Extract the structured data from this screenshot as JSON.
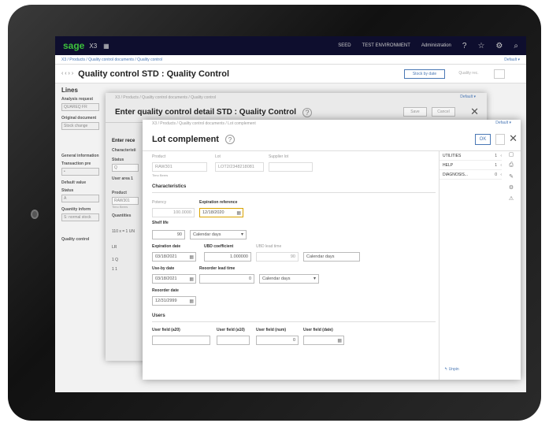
{
  "topbar": {
    "logo": "sage",
    "product": "X3",
    "menu_icon": "grid-icon",
    "links": [
      "SEED",
      "TEST ENVIRONMENT",
      "Administration"
    ],
    "icons": [
      "help-icon",
      "star-icon",
      "settings-icon",
      "search-icon"
    ]
  },
  "breadcrumb": {
    "path": "X3 / Products / Quality control documents / Quality control",
    "default_label": "Default ▾"
  },
  "page": {
    "arrows": "‹ ‹ › ›",
    "title": "Quality control STD : Quality Control",
    "button_primary": "Stock by date",
    "button_secondary": "Quality rec."
  },
  "left_panel": {
    "heading": "Lines",
    "analysis_request_label": "Analysis request",
    "analysis_request_value": "QUAREQ FR",
    "original_document_label": "Original document",
    "original_document_value": "Stock change",
    "general_information_label": "General information",
    "transaction_label": "Transaction pre",
    "transaction_value": "•",
    "default_value_label": "Default value",
    "status_label": "Status",
    "status_value": "A",
    "quantity_label": "Quantity inform",
    "quantity_value": "S: normal stock",
    "quality_control_label": "Quality control"
  },
  "modal1": {
    "crumb": "X3 / Products / Quality control documents / Quality control",
    "default_label": "Default ▾",
    "title": "Enter quality control detail STD : Quality Control",
    "help": "?",
    "btn_save": "Save",
    "btn_cancel": "Cancel",
    "close": "✕",
    "left": {
      "section": "Enter rece",
      "characteristics": "Characteristi",
      "status_label": "Status",
      "status_value": "Q",
      "user_area": "User area 1",
      "product_label": "Product",
      "product_value": "RAW301",
      "product_desc": "Timo Beers",
      "quantities_label": "Quantities",
      "qty_value": "110 x = 1 UN",
      "lot_label": "LR",
      "row_a": "1  Q",
      "row_b": "1  1"
    }
  },
  "modal2": {
    "crumb": "X3 / Products / Quality control documents / Lot complement",
    "default_label": "Default ▾",
    "title": "Lot complement",
    "help": "?",
    "ok": "OK",
    "close": "✕",
    "product_label": "Product",
    "product_value": "RAW301",
    "product_desc": "Timo Beers",
    "lot_label": "Lot",
    "lot_value": "LOT2/2348218081",
    "supplier_lot_label": "Supplier lot",
    "supplier_lot_value": "",
    "characteristics_heading": "Characteristics",
    "potency_label": "Potency",
    "potency_value": "100.0000",
    "expiration_reference_label": "Expiration reference",
    "expiration_reference_value": "12/18/2020",
    "shelf_life_label": "Shelf life",
    "shelf_life_value": "90",
    "shelf_life_unit": "Calendar days",
    "expiration_date_label": "Expiration date",
    "expiration_date_value": "03/18/2021",
    "ubd_coefficient_label": "UBD coefficient",
    "ubd_coefficient_value": "1.000000",
    "ubd_lead_time_label": "UBD lead time",
    "ubd_lead_time_value": "90",
    "ubd_lead_time_unit": "Calendar days",
    "use_by_date_label": "Use-by date",
    "use_by_date_value": "03/18/2021",
    "reorder_lead_time_label": "Reoorder lead time",
    "reorder_lead_time_value": "0",
    "reorder_lead_time_unit": "Calendar days",
    "reorder_date_label": "Reoorder date",
    "reorder_date_value": "12/31/2999",
    "users_heading": "Users",
    "user_field_a20_label": "User field (a20)",
    "user_field_a20_value": "",
    "user_field_a10_label": "User field (a10)",
    "user_field_a10_value": "",
    "user_field_num_label": "User field (num)",
    "user_field_num_value": "0",
    "user_field_date_label": "User field (date)",
    "user_field_date_value": "",
    "side_items": [
      {
        "label": "UTILITIES",
        "count": "1",
        "chevron": "‹"
      },
      {
        "label": "HELP",
        "count": "1",
        "chevron": "‹"
      },
      {
        "label": "DIAGNOSIS...",
        "count": "0",
        "chevron": "‹"
      }
    ],
    "unpin": "↰ Unpin"
  }
}
